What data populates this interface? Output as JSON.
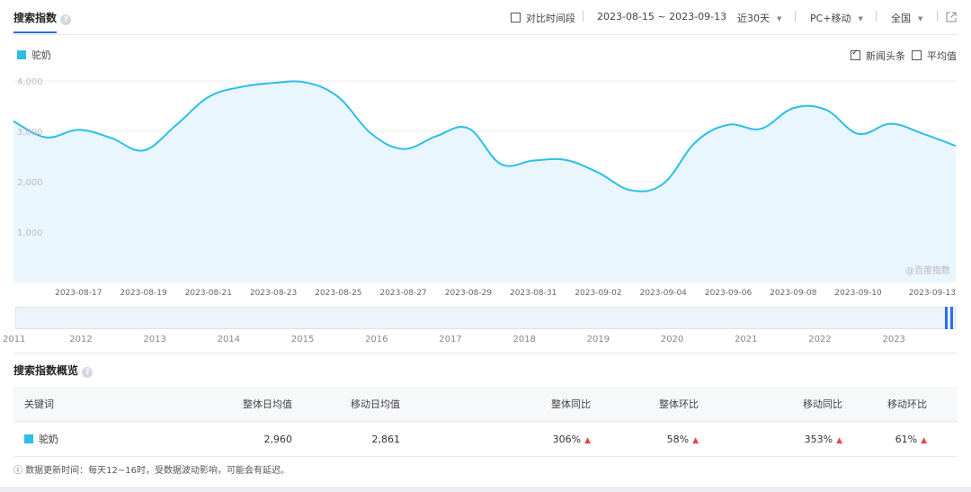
{
  "header": {
    "title": "搜索指数",
    "compare_label": "对比时间段",
    "date_range": "2023-08-15 ~ 2023-09-13",
    "period": "近30天",
    "device": "PC+移动",
    "region": "全国"
  },
  "legend": {
    "series_name": "驼奶",
    "news_label": "新闻头条",
    "news_checked": true,
    "avg_label": "平均值",
    "avg_checked": false
  },
  "watermark": "@百度指数",
  "overview": {
    "title": "搜索指数概览",
    "columns": [
      "关键词",
      "整体日均值",
      "移动日均值",
      "整体同比",
      "整体环比",
      "移动同比",
      "移动环比"
    ],
    "row": {
      "keyword": "驼奶",
      "overall_avg": "2,960",
      "mobile_avg": "2,861",
      "overall_yoy": "306%",
      "overall_mom": "58%",
      "mobile_yoy": "353%",
      "mobile_mom": "61%"
    },
    "footnote": "数据更新时间：每天12~16时，受数据波动影响，可能会有延迟。"
  },
  "chart_data": {
    "type": "area",
    "ylim": [
      0,
      4000
    ],
    "yticks": [
      "4,000",
      "3,000",
      "2,000",
      "1,000"
    ],
    "x": [
      "2023-08-15",
      "2023-08-16",
      "2023-08-17",
      "2023-08-18",
      "2023-08-19",
      "2023-08-20",
      "2023-08-21",
      "2023-08-22",
      "2023-08-23",
      "2023-08-24",
      "2023-08-25",
      "2023-08-26",
      "2023-08-27",
      "2023-08-28",
      "2023-08-29",
      "2023-08-30",
      "2023-08-31",
      "2023-09-01",
      "2023-09-02",
      "2023-09-03",
      "2023-09-04",
      "2023-09-05",
      "2023-09-06",
      "2023-09-07",
      "2023-09-08",
      "2023-09-09",
      "2023-09-10",
      "2023-09-11",
      "2023-09-12",
      "2023-09-13"
    ],
    "xtick_labels": [
      "2023-08-17",
      "2023-08-19",
      "2023-08-21",
      "2023-08-23",
      "2023-08-25",
      "2023-08-27",
      "2023-08-29",
      "2023-08-31",
      "2023-09-02",
      "2023-09-04",
      "2023-09-06",
      "2023-09-08",
      "2023-09-10",
      "2023-09-13"
    ],
    "series": [
      {
        "name": "驼奶",
        "color": "#2bbfe6",
        "values": [
          3200,
          2880,
          3030,
          2870,
          2620,
          3120,
          3680,
          3880,
          3960,
          3970,
          3680,
          2960,
          2650,
          2900,
          3060,
          2350,
          2420,
          2430,
          2180,
          1830,
          1960,
          2790,
          3130,
          3050,
          3460,
          3430,
          2950,
          3150,
          2950,
          2710
        ]
      }
    ],
    "timeline_years": [
      "2011",
      "2012",
      "2013",
      "2014",
      "2015",
      "2016",
      "2017",
      "2018",
      "2019",
      "2020",
      "2021",
      "2022",
      "2023"
    ]
  }
}
